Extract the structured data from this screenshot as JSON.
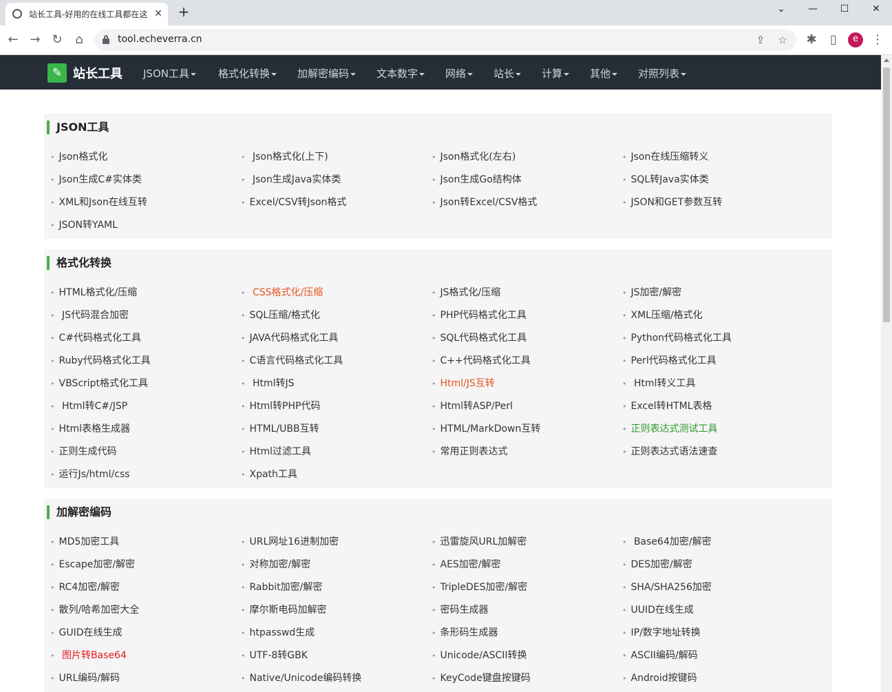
{
  "browser": {
    "tab_title": "站长工具-好用的在线工具都在这",
    "tab_close": "✕",
    "new_tab": "+",
    "url": "tool.echeverra.cn",
    "avatar_letter": "e",
    "window_buttons": {
      "dropdown": "⌄",
      "minimize": "—",
      "maximize": "☐",
      "close": "✕"
    }
  },
  "site": {
    "logo_icon": "wrench-icon",
    "logo_text": "站长工具",
    "nav": [
      {
        "label": "JSON工具"
      },
      {
        "label": "格式化转换"
      },
      {
        "label": "加解密编码"
      },
      {
        "label": "文本数字"
      },
      {
        "label": "网络"
      },
      {
        "label": "站长"
      },
      {
        "label": "计算"
      },
      {
        "label": "其他"
      },
      {
        "label": "对照列表"
      }
    ]
  },
  "sections": [
    {
      "title": "JSON工具",
      "items": [
        {
          "label": "Json格式化"
        },
        {
          "label": " Json格式化(上下)"
        },
        {
          "label": "Json格式化(左右)"
        },
        {
          "label": "Json在线压缩转义"
        },
        {
          "label": "Json生成C#实体类"
        },
        {
          "label": " Json生成Java实体类"
        },
        {
          "label": "Json生成Go结构体"
        },
        {
          "label": "SQL转Java实体类"
        },
        {
          "label": "XML和Json在线互转"
        },
        {
          "label": "Excel/CSV转Json格式"
        },
        {
          "label": "Json转Excel/CSV格式"
        },
        {
          "label": "JSON和GET参数互转"
        },
        {
          "label": "JSON转YAML"
        }
      ]
    },
    {
      "title": "格式化转换",
      "items": [
        {
          "label": "HTML格式化/压缩"
        },
        {
          "label": " CSS格式化/压缩",
          "color": "orange"
        },
        {
          "label": "JS格式化/压缩"
        },
        {
          "label": "JS加密/解密"
        },
        {
          "label": " JS代码混合加密"
        },
        {
          "label": "SQL压缩/格式化"
        },
        {
          "label": "PHP代码格式化工具"
        },
        {
          "label": "XML压缩/格式化"
        },
        {
          "label": "C#代码格式化工具"
        },
        {
          "label": "JAVA代码格式化工具"
        },
        {
          "label": "SQL代码格式化工具"
        },
        {
          "label": "Python代码格式化工具"
        },
        {
          "label": "Ruby代码格式化工具"
        },
        {
          "label": "C语言代码格式化工具"
        },
        {
          "label": "C++代码格式化工具"
        },
        {
          "label": "Perl代码格式化工具"
        },
        {
          "label": "VBScript格式化工具"
        },
        {
          "label": " Html转JS"
        },
        {
          "label": "Html/JS互转",
          "color": "orange"
        },
        {
          "label": " Html转义工具"
        },
        {
          "label": " Html转C#/JSP"
        },
        {
          "label": "Html转PHP代码"
        },
        {
          "label": "Html转ASP/Perl"
        },
        {
          "label": "Excel转HTML表格"
        },
        {
          "label": "Html表格生成器"
        },
        {
          "label": "HTML/UBB互转"
        },
        {
          "label": "HTML/MarkDown互转"
        },
        {
          "label": "正则表达式测试工具",
          "color": "green"
        },
        {
          "label": "正则生成代码"
        },
        {
          "label": "Html过滤工具"
        },
        {
          "label": "常用正则表达式"
        },
        {
          "label": "正则表达式语法速查"
        },
        {
          "label": "运行Js/html/css"
        },
        {
          "label": "Xpath工具"
        }
      ]
    },
    {
      "title": "加解密编码",
      "items": [
        {
          "label": "MD5加密工具"
        },
        {
          "label": "URL网址16进制加密"
        },
        {
          "label": "迅雷旋风URL加解密"
        },
        {
          "label": " Base64加密/解密"
        },
        {
          "label": "Escape加密/解密"
        },
        {
          "label": "对称加密/解密"
        },
        {
          "label": "AES加密/解密"
        },
        {
          "label": "DES加密/解密"
        },
        {
          "label": "RC4加密/解密"
        },
        {
          "label": "Rabbit加密/解密"
        },
        {
          "label": "TripleDES加密/解密"
        },
        {
          "label": "SHA/SHA256加密"
        },
        {
          "label": "散列/哈希加密大全"
        },
        {
          "label": "摩尔斯电码加解密"
        },
        {
          "label": "密码生成器"
        },
        {
          "label": "UUID在线生成"
        },
        {
          "label": "GUID在线生成"
        },
        {
          "label": "htpasswd生成"
        },
        {
          "label": "条形码生成器"
        },
        {
          "label": "IP/数字地址转换"
        },
        {
          "label": " 图片转Base64",
          "color": "red"
        },
        {
          "label": "UTF-8转GBK"
        },
        {
          "label": "Unicode/ASCII转换"
        },
        {
          "label": "ASCII编码/解码"
        },
        {
          "label": "URL编码/解码"
        },
        {
          "label": "Native/Unicode编码转换"
        },
        {
          "label": "KeyCode键盘按键码"
        },
        {
          "label": "Android按键码"
        }
      ]
    }
  ],
  "colors": {
    "header_bg": "#252d37",
    "accent_green": "#4cae4c",
    "logo_green": "#3ab54a",
    "section_bg": "#f5f5f5",
    "link_orange": "#e8531e",
    "link_red": "#e01b1b",
    "link_green": "#2b9a2b"
  }
}
